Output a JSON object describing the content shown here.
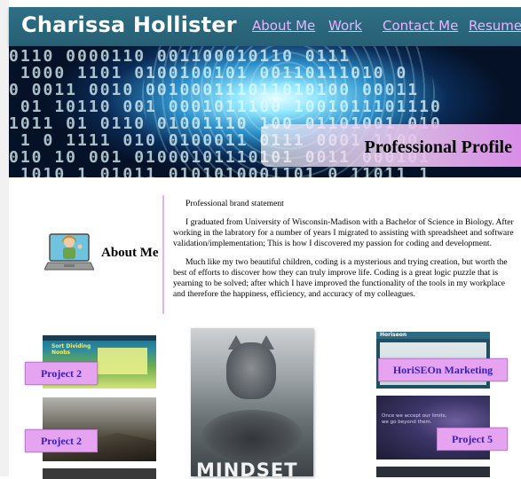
{
  "header": {
    "brand": "Charissa Hollister",
    "nav": [
      {
        "label": "About Me"
      },
      {
        "label": "Work"
      },
      {
        "label": "Contact Me"
      },
      {
        "label": "Resume"
      }
    ]
  },
  "hero": {
    "caption": "Professional Profile"
  },
  "about": {
    "title": "About Me",
    "paragraphs": [
      "Professional brand statement",
      "I graduated from University of Wisconsin-Madison with a Bachelor of Science in Biology. After working in the labratory for a number of years I migrated to assisting with spreadsheet and software validation/implementation; This is how I discovered my passion for coding and development.",
      "Much like my two beautiful children, coding is a mysterious and trying creation, but worth the best of efforts to discover how they can truly improve life. Coding is a great logic puzzle that is yearning to be solved; after which I have improved the functionality of the tools in my workplace and therefore the happiness, efficiency, and accuracy of my colleagues."
    ]
  },
  "work": {
    "thumb_text": {
      "sort_dividing": "Sort Dividing\nNoobs",
      "horiseon_brand": "Horiseon",
      "quote": "Once we accept our limits,\nwe go beyond them.",
      "mindset": "MINDSET"
    },
    "projects": [
      {
        "label": "Project 2"
      },
      {
        "label": "Project 2"
      },
      {
        "label": "HoriSEOn Marketing"
      },
      {
        "label": "Project 5"
      }
    ]
  },
  "colors": {
    "nav_bg": "#2f6f85",
    "nav_link": "#e9b4ff",
    "badge_bg": "#e5a3f0",
    "badge_text": "#3a1fbf",
    "divider": "#e2b4f0"
  },
  "icons": {
    "avatar": "laptop-avatar-icon"
  }
}
